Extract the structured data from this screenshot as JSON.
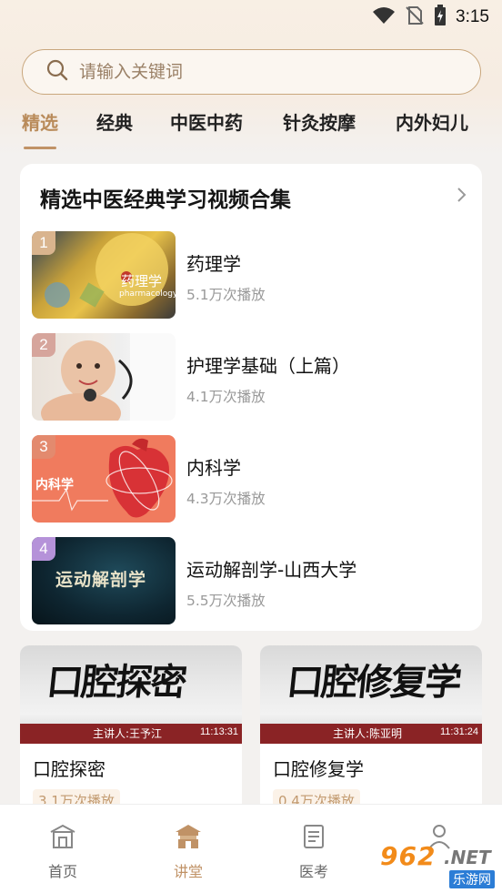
{
  "status_bar": {
    "time": "3:15"
  },
  "search": {
    "placeholder": "请输入关键词"
  },
  "tabs": [
    {
      "label": "精选",
      "active": true
    },
    {
      "label": "经典"
    },
    {
      "label": "中医中药"
    },
    {
      "label": "针灸按摩"
    },
    {
      "label": "内外妇儿"
    }
  ],
  "featured": {
    "title": "精选中医经典学习视频合集",
    "items": [
      {
        "rank": "1",
        "title": "药理学",
        "plays": "5.1万次播放",
        "thumb_text": "药理学",
        "thumb_sub": "pharmacology"
      },
      {
        "rank": "2",
        "title": "护理学基础（上篇）",
        "plays": "4.1万次播放"
      },
      {
        "rank": "3",
        "title": "内科学",
        "plays": "4.3万次播放",
        "thumb_text": "内科学"
      },
      {
        "rank": "4",
        "title": "运动解剖学-山西大学",
        "plays": "5.5万次播放",
        "thumb_text": "运动解剖学"
      }
    ]
  },
  "courses": [
    {
      "title": "口腔探密",
      "plays": "3.1万次播放",
      "calligraphy": "口腔探密",
      "lecturer": "主讲人:王予江",
      "duration": "11:13:31"
    },
    {
      "title": "口腔修复学",
      "plays": "0.4万次播放",
      "calligraphy": "口腔修复学",
      "lecturer": "主讲人:陈亚明",
      "duration": "11:31:24"
    }
  ],
  "bottom_nav": [
    {
      "label": "首页"
    },
    {
      "label": "讲堂",
      "active": true
    },
    {
      "label": "医考"
    },
    {
      "label": ""
    }
  ],
  "watermark": {
    "num": "962",
    "net": ".NET",
    "sub": "乐游网"
  },
  "colors": {
    "accent": "#c09266",
    "rank1": "#d9b48e",
    "rank2": "#d6a59c",
    "rank3": "#e38a6e",
    "rank4": "#b592d9"
  }
}
